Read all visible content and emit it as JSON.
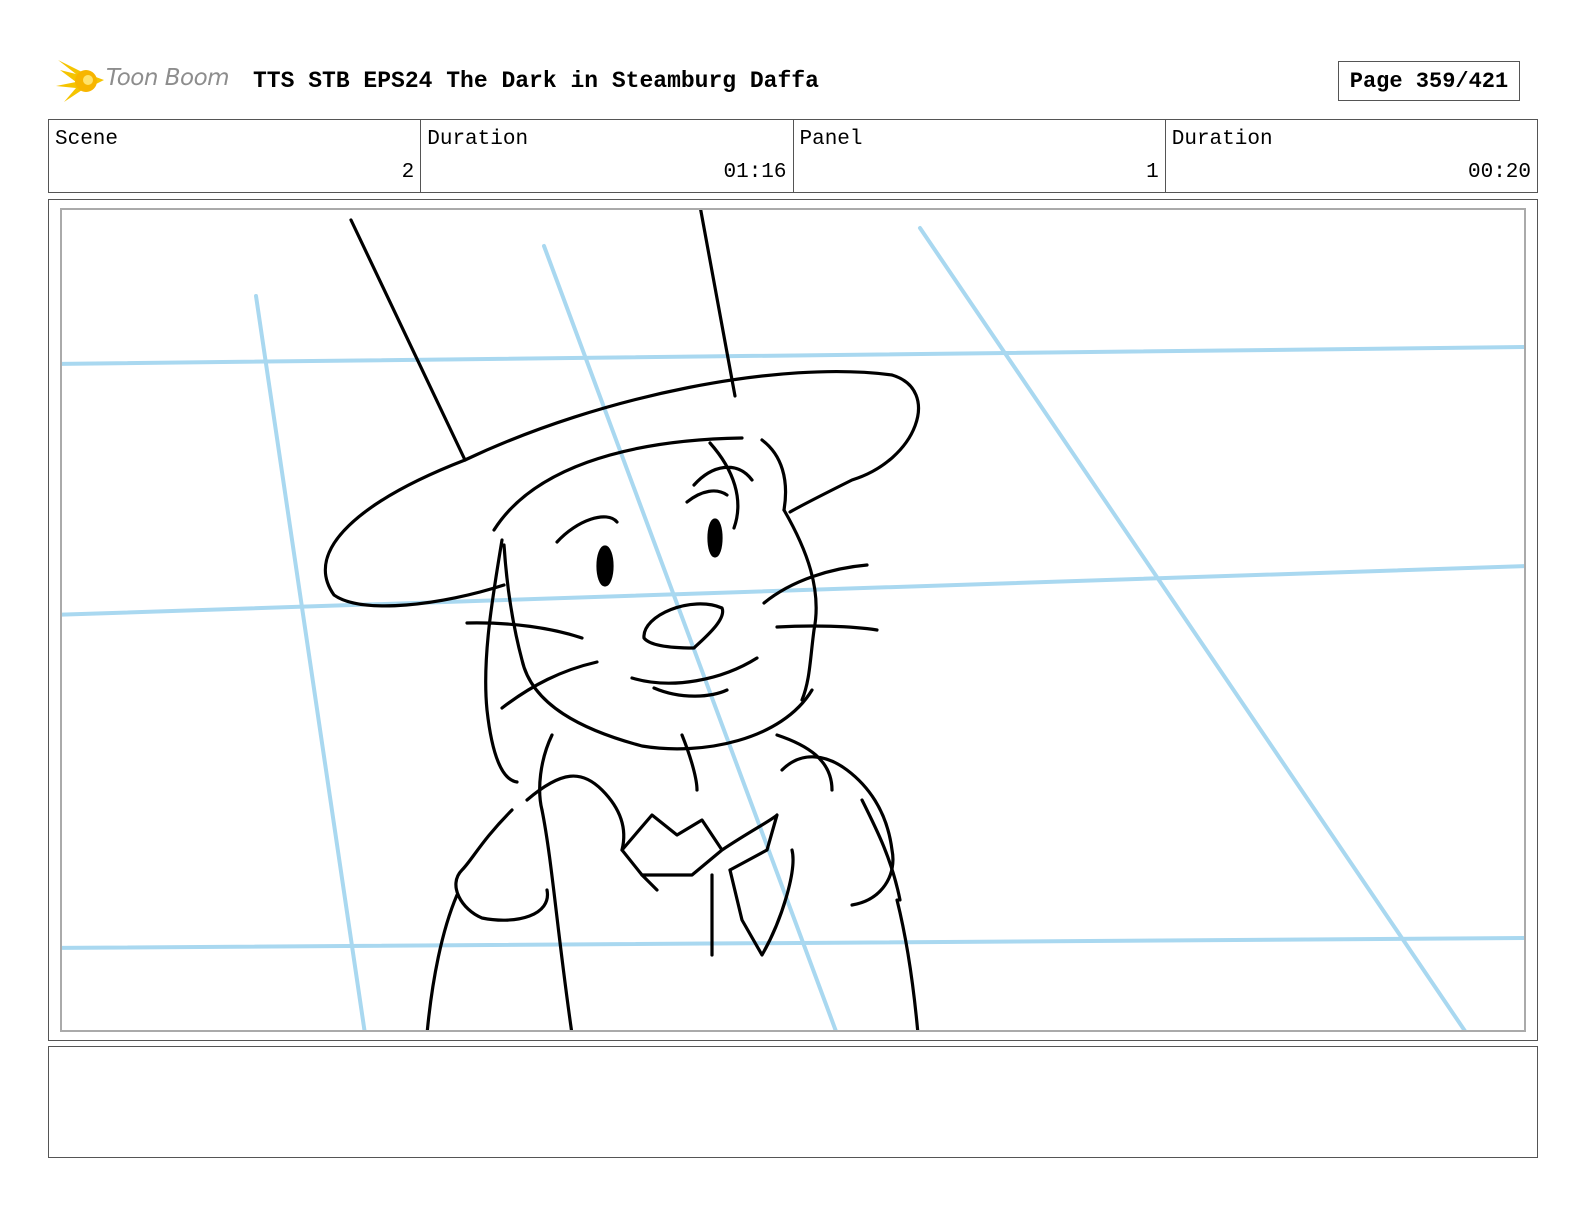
{
  "header": {
    "logo_text": "Toon Boom",
    "title": "TTS STB EPS24 The Dark in Steamburg Daffa",
    "page": "Page 359/421"
  },
  "info": {
    "scene_label": "Scene",
    "scene_value": "2",
    "scene_duration_label": "Duration",
    "scene_duration_value": "01:16",
    "panel_label": "Panel",
    "panel_value": "1",
    "panel_duration_label": "Duration",
    "panel_duration_value": "00:20"
  },
  "colors": {
    "guide_lines": "#a9d8f0",
    "sketch": "#000000",
    "logo_accent": "#f5c400"
  },
  "icons": {
    "logo": "toon-boom-star-icon"
  }
}
